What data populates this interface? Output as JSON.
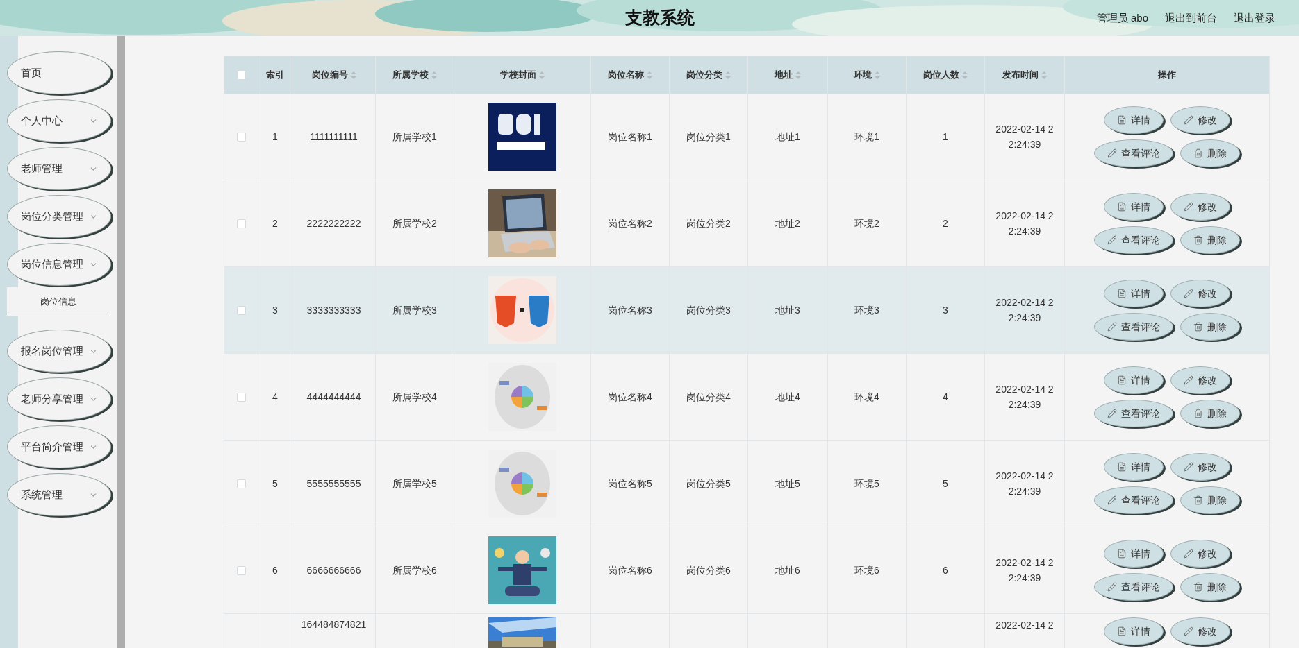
{
  "header": {
    "title": "支教系统",
    "links": [
      {
        "label": "管理员 abo"
      },
      {
        "label": "退出到前台"
      },
      {
        "label": "退出登录"
      }
    ]
  },
  "sidebar": {
    "items": [
      {
        "label": "首页",
        "kind": "link"
      },
      {
        "label": "个人中心",
        "kind": "menu"
      },
      {
        "label": "老师管理",
        "kind": "menu"
      },
      {
        "label": "岗位分类管理",
        "kind": "menu"
      },
      {
        "label": "岗位信息管理",
        "kind": "menu",
        "children": [
          {
            "label": "岗位信息"
          }
        ]
      },
      {
        "label": "报名岗位管理",
        "kind": "menu"
      },
      {
        "label": "老师分享管理",
        "kind": "menu"
      },
      {
        "label": "平台简介管理",
        "kind": "menu"
      },
      {
        "label": "系统管理",
        "kind": "menu"
      }
    ]
  },
  "table": {
    "select_all": {
      "checked": false
    },
    "columns": [
      {
        "label": "索引",
        "sortable": false
      },
      {
        "label": "岗位编号",
        "sortable": true
      },
      {
        "label": "所属学校",
        "sortable": true
      },
      {
        "label": "学校封面",
        "sortable": true
      },
      {
        "label": "岗位名称",
        "sortable": true
      },
      {
        "label": "岗位分类",
        "sortable": true
      },
      {
        "label": "地址",
        "sortable": true
      },
      {
        "label": "环境",
        "sortable": true
      },
      {
        "label": "岗位人数",
        "sortable": true
      },
      {
        "label": "发布时间",
        "sortable": true
      },
      {
        "label": "操作",
        "sortable": false
      }
    ],
    "rows": [
      {
        "checked": false,
        "highlighted": false,
        "partial": false,
        "index": "1",
        "code": "1111111111",
        "school": "所属学校1",
        "cover": {
          "kind": "picture"
        },
        "name": "岗位名称1",
        "category": "岗位分类1",
        "address": "地址1",
        "environment": "环境1",
        "count": "1",
        "time": "2022-02-14 22:24:39",
        "actions": [
          {
            "kind": "detail",
            "label": "详情"
          },
          {
            "kind": "edit",
            "label": "修改"
          },
          {
            "kind": "comments",
            "label": "查看评论"
          },
          {
            "kind": "delete",
            "label": "删除"
          }
        ]
      },
      {
        "checked": false,
        "highlighted": false,
        "partial": false,
        "index": "2",
        "code": "2222222222",
        "school": "所属学校2",
        "cover": {
          "kind": "picture"
        },
        "name": "岗位名称2",
        "category": "岗位分类2",
        "address": "地址2",
        "environment": "环境2",
        "count": "2",
        "time": "2022-02-14 22:24:39",
        "actions": [
          {
            "kind": "detail",
            "label": "详情"
          },
          {
            "kind": "edit",
            "label": "修改"
          },
          {
            "kind": "comments",
            "label": "查看评论"
          },
          {
            "kind": "delete",
            "label": "删除"
          }
        ]
      },
      {
        "checked": false,
        "highlighted": true,
        "partial": false,
        "index": "3",
        "code": "3333333333",
        "school": "所属学校3",
        "cover": {
          "kind": "picture"
        },
        "name": "岗位名称3",
        "category": "岗位分类3",
        "address": "地址3",
        "environment": "环境3",
        "count": "3",
        "time": "2022-02-14 22:24:39",
        "actions": [
          {
            "kind": "detail",
            "label": "详情"
          },
          {
            "kind": "edit",
            "label": "修改"
          },
          {
            "kind": "comments",
            "label": "查看评论"
          },
          {
            "kind": "delete",
            "label": "删除"
          }
        ]
      },
      {
        "checked": false,
        "highlighted": false,
        "partial": false,
        "index": "4",
        "code": "4444444444",
        "school": "所属学校4",
        "cover": {
          "kind": "picture"
        },
        "name": "岗位名称4",
        "category": "岗位分类4",
        "address": "地址4",
        "environment": "环境4",
        "count": "4",
        "time": "2022-02-14 22:24:39",
        "actions": [
          {
            "kind": "detail",
            "label": "详情"
          },
          {
            "kind": "edit",
            "label": "修改"
          },
          {
            "kind": "comments",
            "label": "查看评论"
          },
          {
            "kind": "delete",
            "label": "删除"
          }
        ]
      },
      {
        "checked": false,
        "highlighted": false,
        "partial": false,
        "index": "5",
        "code": "5555555555",
        "school": "所属学校5",
        "cover": {
          "kind": "picture"
        },
        "name": "岗位名称5",
        "category": "岗位分类5",
        "address": "地址5",
        "environment": "环境5",
        "count": "5",
        "time": "2022-02-14 22:24:39",
        "actions": [
          {
            "kind": "detail",
            "label": "详情"
          },
          {
            "kind": "edit",
            "label": "修改"
          },
          {
            "kind": "comments",
            "label": "查看评论"
          },
          {
            "kind": "delete",
            "label": "删除"
          }
        ]
      },
      {
        "checked": false,
        "highlighted": false,
        "partial": false,
        "index": "6",
        "code": "6666666666",
        "school": "所属学校6",
        "cover": {
          "kind": "picture"
        },
        "name": "岗位名称6",
        "category": "岗位分类6",
        "address": "地址6",
        "environment": "环境6",
        "count": "6",
        "time": "2022-02-14 22:24:39",
        "actions": [
          {
            "kind": "detail",
            "label": "详情"
          },
          {
            "kind": "edit",
            "label": "修改"
          },
          {
            "kind": "comments",
            "label": "查看评论"
          },
          {
            "kind": "delete",
            "label": "删除"
          }
        ]
      },
      {
        "partial": true,
        "code": "164484874821",
        "cover": {
          "kind": "picture"
        },
        "time": "2022-02-14 2",
        "actions": [
          {
            "kind": "detail",
            "label": "详情"
          },
          {
            "kind": "edit",
            "label": "修改"
          }
        ]
      }
    ]
  }
}
